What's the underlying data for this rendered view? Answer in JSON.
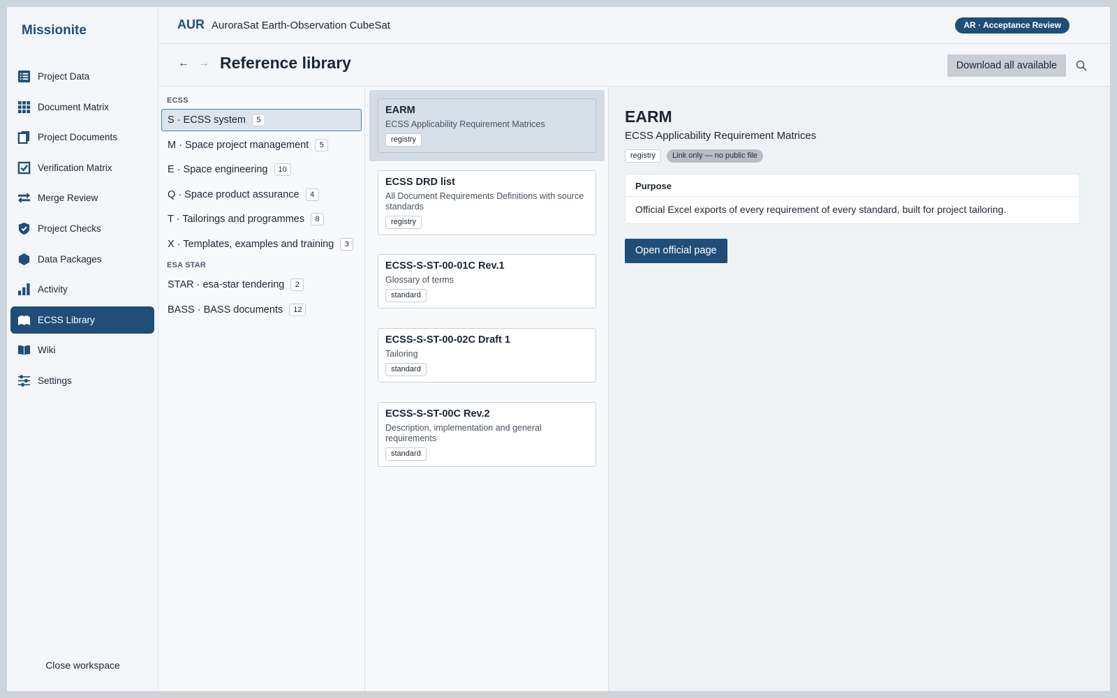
{
  "app": {
    "name": "Missionite"
  },
  "sidebar": {
    "items": [
      {
        "label": "Project Data",
        "icon": "list-icon"
      },
      {
        "label": "Document Matrix",
        "icon": "grid-icon"
      },
      {
        "label": "Project Documents",
        "icon": "documents-icon"
      },
      {
        "label": "Verification Matrix",
        "icon": "checkbox-icon"
      },
      {
        "label": "Merge Review",
        "icon": "merge-arrows-icon"
      },
      {
        "label": "Project Checks",
        "icon": "shield-check-icon"
      },
      {
        "label": "Data Packages",
        "icon": "hexagon-icon"
      },
      {
        "label": "Activity",
        "icon": "bar-chart-icon"
      },
      {
        "label": "ECSS Library",
        "icon": "library-icon",
        "active": true
      },
      {
        "label": "Wiki",
        "icon": "book-icon"
      },
      {
        "label": "Settings",
        "icon": "sliders-icon"
      }
    ],
    "close_label": "Close workspace"
  },
  "header": {
    "project_code": "AUR",
    "project_name": "AuroraSat Earth-Observation CubeSat",
    "phase_badge": "AR · Acceptance Review"
  },
  "subheader": {
    "title": "Reference library",
    "download_label": "Download all available"
  },
  "categories": {
    "groups": [
      {
        "label": "ECSS",
        "items": [
          {
            "label": "S · ECSS system",
            "count": "5",
            "selected": true
          },
          {
            "label": "M · Space project management",
            "count": "5"
          },
          {
            "label": "E · Space engineering",
            "count": "10"
          },
          {
            "label": "Q · Space product assurance",
            "count": "4"
          },
          {
            "label": "T · Tailorings and programmes",
            "count": "8"
          },
          {
            "label": "X · Templates, examples and training",
            "count": "3"
          }
        ]
      },
      {
        "label": "ESA STAR",
        "items": [
          {
            "label": "STAR · esa-star tendering",
            "count": "2"
          },
          {
            "label": "BASS · BASS documents",
            "count": "12"
          }
        ]
      }
    ]
  },
  "documents": [
    {
      "title": "EARM",
      "subtitle": "ECSS Applicability Requirement Matrices",
      "tag": "registry",
      "selected": true
    },
    {
      "title": "ECSS DRD list",
      "subtitle": "All Document Requirements Definitions with source standards",
      "tag": "registry"
    },
    {
      "title": "ECSS-S-ST-00-01C Rev.1",
      "subtitle": "Glossary of terms",
      "tag": "standard"
    },
    {
      "title": "ECSS-S-ST-00-02C Draft 1",
      "subtitle": "Tailoring",
      "tag": "standard"
    },
    {
      "title": "ECSS-S-ST-00C Rev.2",
      "subtitle": "Description, implementation and general requirements",
      "tag": "standard"
    }
  ],
  "detail": {
    "title": "EARM",
    "subtitle": "ECSS Applicability Requirement Matrices",
    "tags": [
      "registry",
      "Link only — no public file"
    ],
    "purpose_header": "Purpose",
    "purpose_text": "Official Excel exports of every requirement of every standard, built for project tailoring.",
    "open_label": "Open official page"
  },
  "colors": {
    "accent": "#1f4e79",
    "background": "#f4f6f9",
    "selected": "#dde4ec"
  }
}
